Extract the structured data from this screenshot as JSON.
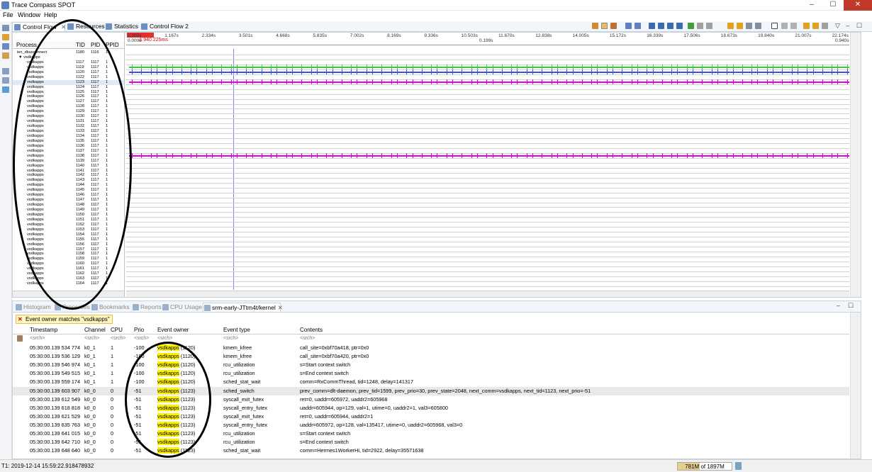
{
  "window": {
    "title": "Trace Compass SPOT",
    "min": "–",
    "max": "☐",
    "close": "✕"
  },
  "menu": [
    "File",
    "Window",
    "Help"
  ],
  "top_tabs": [
    {
      "label": "Control Flow",
      "close": "✕"
    },
    {
      "label": "Resources"
    },
    {
      "label": "Statistics"
    },
    {
      "label": "Control Flow 2"
    }
  ],
  "tree": {
    "headers": {
      "process": "Process",
      "tid": "TID",
      "pid": "PID",
      "ppid": "PPID"
    },
    "rows": [
      {
        "name": "ien_dbusconnect",
        "tid": "1180",
        "pid": "1116",
        "ppid": "1"
      },
      {
        "name": "▼ vsdkapps",
        "tid": "",
        "pid": "",
        "ppid": ""
      },
      {
        "name": "vsdkapps",
        "tid": "1117",
        "pid": "1117",
        "ppid": "1"
      },
      {
        "name": "vsdkapps",
        "tid": "1119",
        "pid": "1117",
        "ppid": "1"
      },
      {
        "name": "vsdkapps",
        "tid": "1120",
        "pid": "1117",
        "ppid": "1"
      },
      {
        "name": "vsdkapps",
        "tid": "1122",
        "pid": "1117",
        "ppid": "1"
      },
      {
        "name": "vsdkapps",
        "tid": "1123",
        "pid": "1117",
        "ppid": "1"
      },
      {
        "name": "vsdkapps",
        "tid": "1124",
        "pid": "1117",
        "ppid": "1"
      },
      {
        "name": "vsdkapps",
        "tid": "1125",
        "pid": "1117",
        "ppid": "1"
      },
      {
        "name": "vsdkapps",
        "tid": "1126",
        "pid": "1117",
        "ppid": "1"
      },
      {
        "name": "vsdkapps",
        "tid": "1127",
        "pid": "1117",
        "ppid": "1"
      },
      {
        "name": "vsdkapps",
        "tid": "1128",
        "pid": "1117",
        "ppid": "1"
      },
      {
        "name": "vsdkapps",
        "tid": "1129",
        "pid": "1117",
        "ppid": "1"
      },
      {
        "name": "vsdkapps",
        "tid": "1130",
        "pid": "1117",
        "ppid": "1"
      },
      {
        "name": "vsdkapps",
        "tid": "1131",
        "pid": "1117",
        "ppid": "1"
      },
      {
        "name": "vsdkapps",
        "tid": "1132",
        "pid": "1117",
        "ppid": "1"
      },
      {
        "name": "vsdkapps",
        "tid": "1133",
        "pid": "1117",
        "ppid": "1"
      },
      {
        "name": "vsdkapps",
        "tid": "1134",
        "pid": "1117",
        "ppid": "1"
      },
      {
        "name": "vsdkapps",
        "tid": "1135",
        "pid": "1117",
        "ppid": "1"
      },
      {
        "name": "vsdkapps",
        "tid": "1136",
        "pid": "1117",
        "ppid": "1"
      },
      {
        "name": "vsdkapps",
        "tid": "1137",
        "pid": "1117",
        "ppid": "1"
      },
      {
        "name": "vsdkapps",
        "tid": "1138",
        "pid": "1117",
        "ppid": "1"
      },
      {
        "name": "vsdkapps",
        "tid": "1139",
        "pid": "1117",
        "ppid": "1"
      },
      {
        "name": "vsdkapps",
        "tid": "1140",
        "pid": "1117",
        "ppid": "1"
      },
      {
        "name": "vsdkapps",
        "tid": "1141",
        "pid": "1117",
        "ppid": "1"
      },
      {
        "name": "vsdkapps",
        "tid": "1142",
        "pid": "1117",
        "ppid": "1"
      },
      {
        "name": "vsdkapps",
        "tid": "1143",
        "pid": "1117",
        "ppid": "1"
      },
      {
        "name": "vsdkapps",
        "tid": "1144",
        "pid": "1117",
        "ppid": "1"
      },
      {
        "name": "vsdkapps",
        "tid": "1145",
        "pid": "1117",
        "ppid": "1"
      },
      {
        "name": "vsdkapps",
        "tid": "1146",
        "pid": "1117",
        "ppid": "1"
      },
      {
        "name": "vsdkapps",
        "tid": "1147",
        "pid": "1117",
        "ppid": "1"
      },
      {
        "name": "vsdkapps",
        "tid": "1148",
        "pid": "1117",
        "ppid": "1"
      },
      {
        "name": "vsdkapps",
        "tid": "1149",
        "pid": "1117",
        "ppid": "1"
      },
      {
        "name": "vsdkapps",
        "tid": "1150",
        "pid": "1117",
        "ppid": "1"
      },
      {
        "name": "vsdkapps",
        "tid": "1151",
        "pid": "1117",
        "ppid": "1"
      },
      {
        "name": "vsdkapps",
        "tid": "1152",
        "pid": "1117",
        "ppid": "1"
      },
      {
        "name": "vsdkapps",
        "tid": "1153",
        "pid": "1117",
        "ppid": "1"
      },
      {
        "name": "vsdkapps",
        "tid": "1154",
        "pid": "1117",
        "ppid": "1"
      },
      {
        "name": "vsdkapps",
        "tid": "1155",
        "pid": "1117",
        "ppid": "1"
      },
      {
        "name": "vsdkapps",
        "tid": "1156",
        "pid": "1117",
        "ppid": "1"
      },
      {
        "name": "vsdkapps",
        "tid": "1157",
        "pid": "1117",
        "ppid": "1"
      },
      {
        "name": "vsdkapps",
        "tid": "1158",
        "pid": "1117",
        "ppid": "1"
      },
      {
        "name": "vsdkapps",
        "tid": "1159",
        "pid": "1117",
        "ppid": "1"
      },
      {
        "name": "vsdkapps",
        "tid": "1160",
        "pid": "1117",
        "ppid": "1"
      },
      {
        "name": "vsdkapps",
        "tid": "1161",
        "pid": "1117",
        "ppid": "1"
      },
      {
        "name": "vsdkapps",
        "tid": "1162",
        "pid": "1117",
        "ppid": "1"
      },
      {
        "name": "vsdkapps",
        "tid": "1163",
        "pid": "1117",
        "ppid": "1"
      },
      {
        "name": "vsdkapps",
        "tid": "1164",
        "pid": "1117",
        "ppid": "1"
      }
    ],
    "selected_row": 6
  },
  "ruler": {
    "ticks": [
      "0.000s",
      "1.167s",
      "2.334s",
      "3.501s",
      "4.668s",
      "5.835s",
      "7.002s",
      "8.169s",
      "9.336s",
      "10.503s",
      "11.670s",
      "12.838s",
      "14.005s",
      "15.172s",
      "16.339s",
      "17.506s",
      "18.673s",
      "19.840s",
      "21.007s",
      "22.174s"
    ],
    "sub_left": "0.000s",
    "sub_mid": "0.199s",
    "sub_right": "0.940s",
    "selection": "Δ 940.225ms"
  },
  "bottom_tabs": [
    {
      "label": "Histogram"
    },
    {
      "label": "Properties"
    },
    {
      "label": "Bookmarks"
    },
    {
      "label": "Reports"
    },
    {
      "label": "CPU Usage"
    },
    {
      "label": "srm-early-JTtm4t/kernel",
      "close": "✕"
    }
  ],
  "filter": {
    "label": "Event owner matches \"vsdkapps\"",
    "close": "✕"
  },
  "events": {
    "columns": [
      "Timestamp",
      "Channel",
      "CPU",
      "Prio",
      "Event owner",
      "Event type",
      "Contents"
    ],
    "search_placeholder": "<srch>",
    "highlight": "vsdkapps",
    "rows": [
      {
        "ts": "05:30:00.139 534 774",
        "ch": "k0_1",
        "cpu": "1",
        "prio": "-100",
        "owner": "(1120)",
        "type": "kmem_kfree",
        "contents": "call_site=0xbf70a418, ptr=0x0"
      },
      {
        "ts": "05:30:00.139 536 129",
        "ch": "k0_1",
        "cpu": "1",
        "prio": "-100",
        "owner": "(1120)",
        "type": "kmem_kfree",
        "contents": "call_site=0xbf70a420, ptr=0x0"
      },
      {
        "ts": "05:30:00.139 546 974",
        "ch": "k0_1",
        "cpu": "1",
        "prio": "-100",
        "owner": "(1120)",
        "type": "rcu_utilization",
        "contents": "s=Start context switch"
      },
      {
        "ts": "05:30:00.139 549 515",
        "ch": "k0_1",
        "cpu": "1",
        "prio": "-100",
        "owner": "(1120)",
        "type": "rcu_utilization",
        "contents": "s=End context switch"
      },
      {
        "ts": "05:30:00.139 559 174",
        "ch": "k0_1",
        "cpu": "1",
        "prio": "-100",
        "owner": "(1120)",
        "type": "sched_stat_wait",
        "contents": "comm=RxCommThread, tid=1248, delay=141317"
      },
      {
        "ts": "05:30:00.139 603 907",
        "ch": "k0_0",
        "cpu": "0",
        "prio": "-51",
        "owner": "(1123)",
        "type": "sched_switch",
        "contents": "prev_comm=dlt-daemon, prev_tid=1599, prev_prio=30, prev_state=2048, next_comm=vsdkapps, next_tid=1123, next_prio=-51"
      },
      {
        "ts": "05:30:00.139 612 549",
        "ch": "k0_0",
        "cpu": "0",
        "prio": "-51",
        "owner": "(1123)",
        "type": "syscall_exit_futex",
        "contents": "ret=0, uaddr=605972, uaddr2=605968"
      },
      {
        "ts": "05:30:00.139 618 818",
        "ch": "k0_0",
        "cpu": "0",
        "prio": "-51",
        "owner": "(1123)",
        "type": "syscall_entry_futex",
        "contents": "uaddr=605944, op=129, val=1, utime=0, uaddr2=1, val3=605800"
      },
      {
        "ts": "05:30:00.139 621 529",
        "ch": "k0_0",
        "cpu": "0",
        "prio": "-51",
        "owner": "(1123)",
        "type": "syscall_exit_futex",
        "contents": "ret=0, uaddr=605944, uaddr2=1"
      },
      {
        "ts": "05:30:00.139 635 763",
        "ch": "k0_0",
        "cpu": "0",
        "prio": "-51",
        "owner": "(1123)",
        "type": "syscall_entry_futex",
        "contents": "uaddr=605972, op=128, val=135417, utime=0, uaddr2=605968, val3=0"
      },
      {
        "ts": "05:30:00.139 641 015",
        "ch": "k0_0",
        "cpu": "0",
        "prio": "-51",
        "owner": "(1123)",
        "type": "rcu_utilization",
        "contents": "s=Start context switch"
      },
      {
        "ts": "05:30:00.139 642 710",
        "ch": "k0_0",
        "cpu": "0",
        "prio": "-51",
        "owner": "(1123)",
        "type": "rcu_utilization",
        "contents": "s=End context switch"
      },
      {
        "ts": "05:30:00.139 648 640",
        "ch": "k0_0",
        "cpu": "0",
        "prio": "-51",
        "owner": "(1123)",
        "type": "sched_stat_wait",
        "contents": "comm=Hermes1WorkerHi, tid=2922, delay=35571638"
      }
    ],
    "highlighted_row": 5
  },
  "status": {
    "t1": "T1: 2019-12-14 15:59:22.918478932",
    "mem_used": "781M",
    "mem_total": "of 1897M",
    "mem_fraction": 0.41
  },
  "colors": {
    "green": "#3cc83c",
    "blue": "#3c50e6",
    "magenta": "#e600e6",
    "highlight": "#fff200"
  }
}
